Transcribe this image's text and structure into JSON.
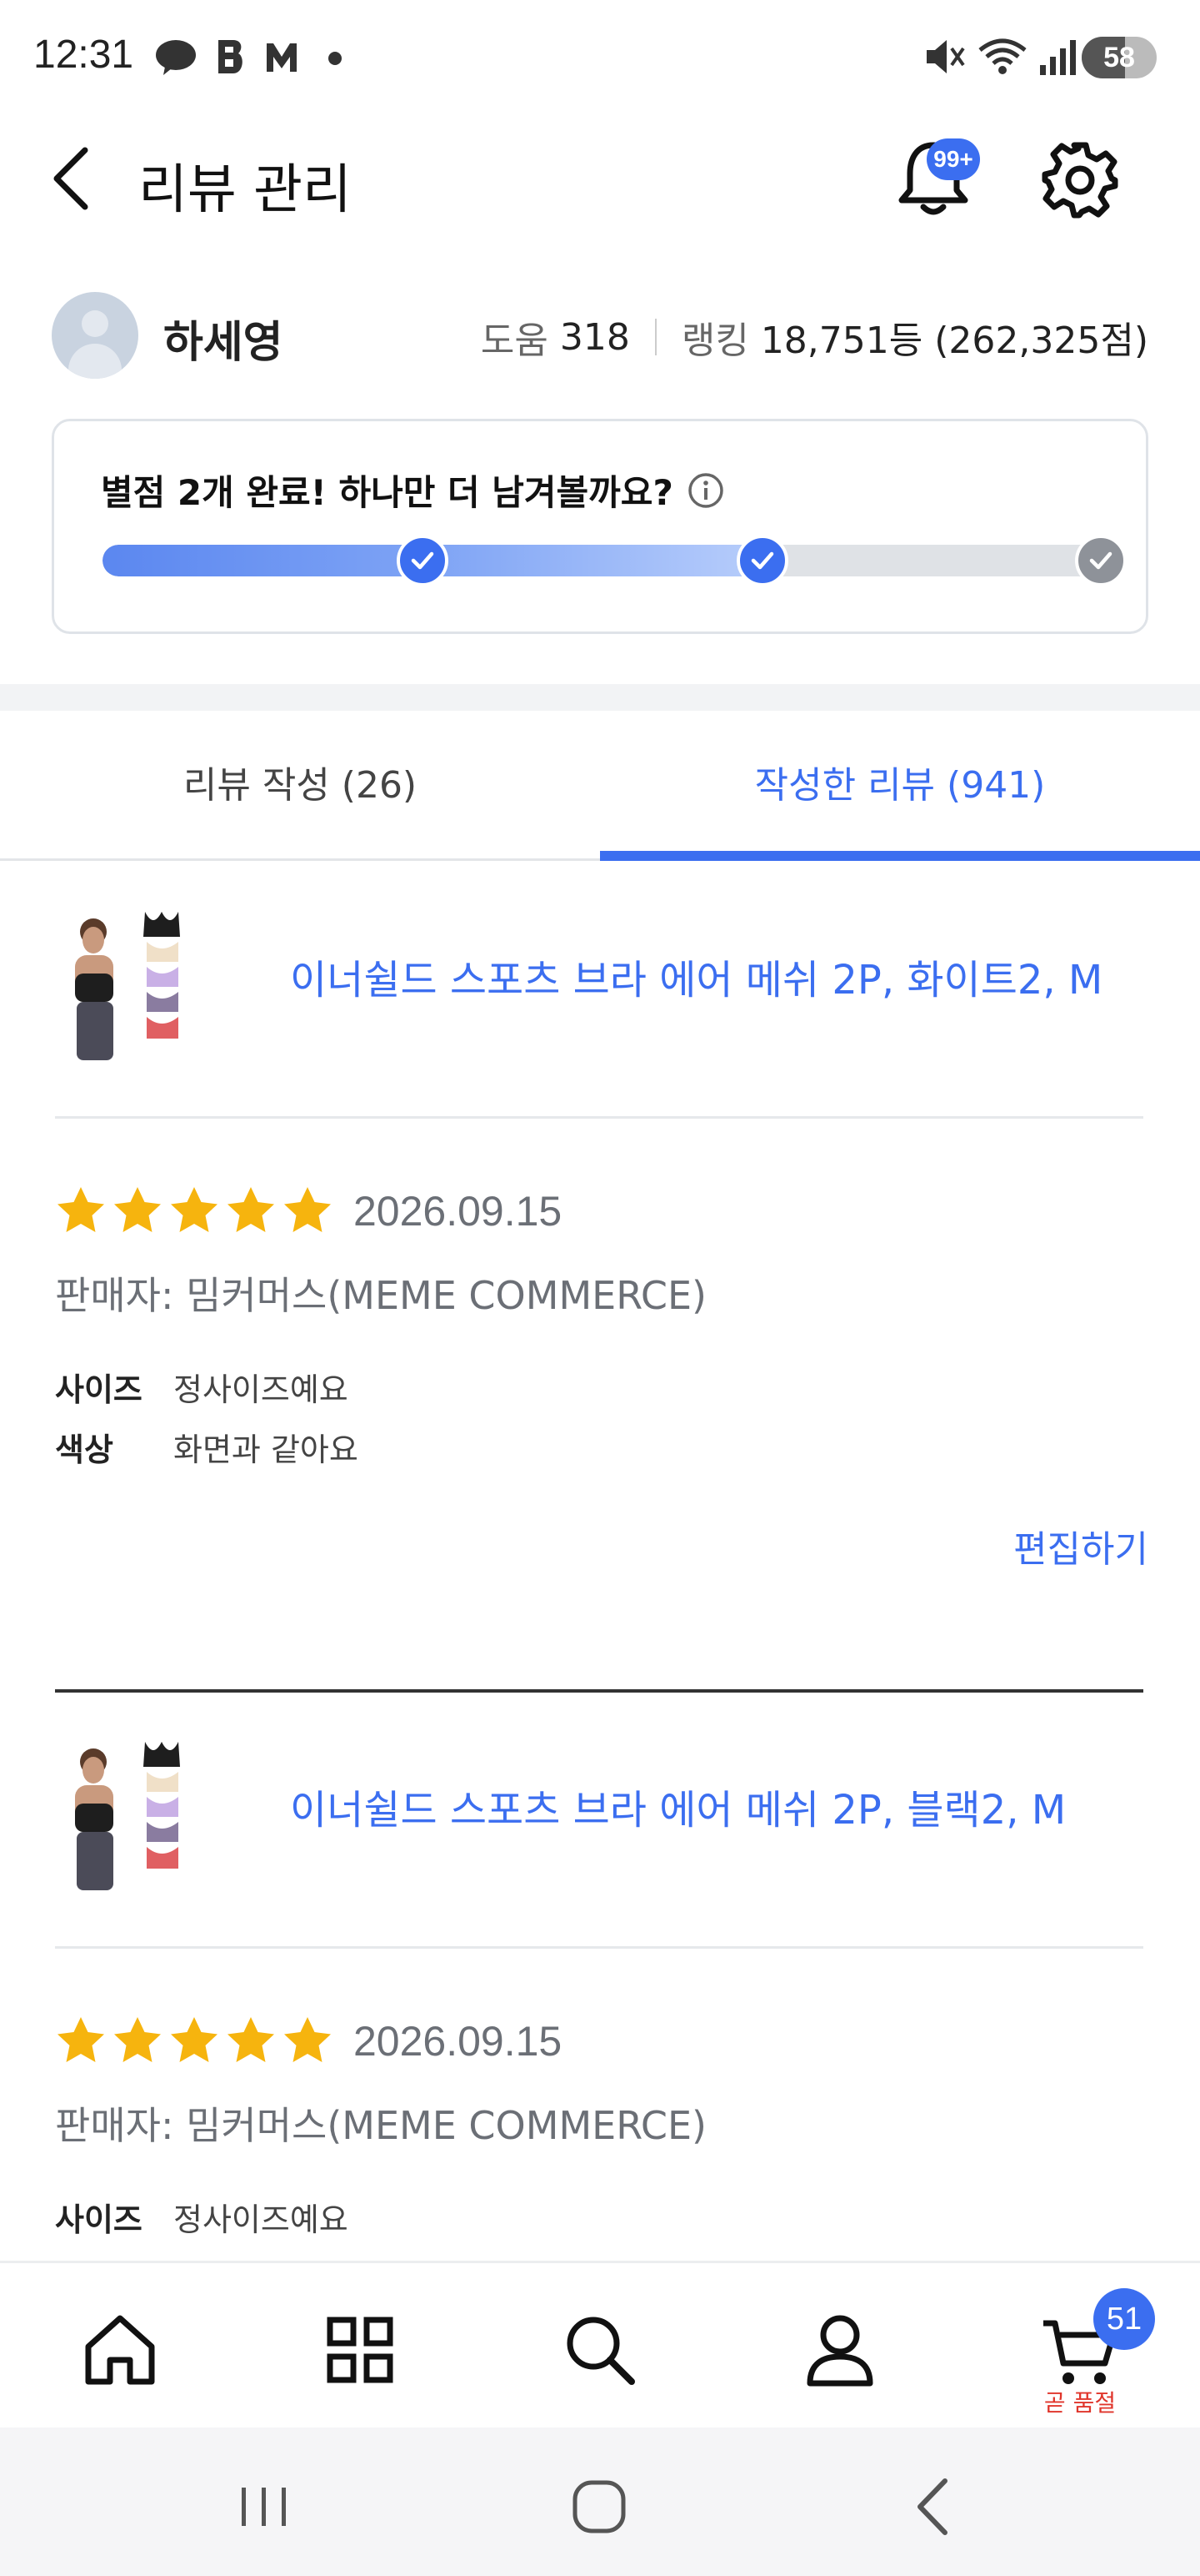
{
  "status_bar": {
    "time": "12:31",
    "battery": "58",
    "battery_level": 0.58,
    "left_icons": [
      "talk-icon",
      "b-app-icon",
      "m-app-icon",
      "dot-icon"
    ],
    "right_icons": [
      "mute-icon",
      "wifi-icon",
      "signal-icon",
      "battery-icon"
    ]
  },
  "header": {
    "title": "리뷰 관리",
    "notification_badge": "99+"
  },
  "profile": {
    "name": "하세영",
    "help_label": "도움",
    "help_value": "318",
    "ranking_label": "랭킹",
    "ranking_value": "18,751등 (262,325점)"
  },
  "progress": {
    "message": "별점 2개 완료! 하나만 더 남겨볼까요?",
    "completed_steps": 2,
    "total_steps": 3
  },
  "tabs": [
    {
      "label": "리뷰 작성 (26)",
      "active": false
    },
    {
      "label": "작성한 리뷰 (941)",
      "active": true
    }
  ],
  "reviews": [
    {
      "product_name": "이너쉴드 스포츠 브라 에어 메쉬 2P, 화이트2, M",
      "rating": 5,
      "date": "2026.09.15",
      "seller": "판매자: 밈커머스(MEME COMMERCE)",
      "attributes": [
        {
          "key": "사이즈",
          "value": "정사이즈예요"
        },
        {
          "key": "색상",
          "value": "화면과 같아요"
        }
      ],
      "edit_label": "편집하기"
    },
    {
      "product_name": "이너쉴드 스포츠 브라 에어 메쉬 2P, 블랙2, M",
      "rating": 5,
      "date": "2026.09.15",
      "seller": "판매자: 밈커머스(MEME COMMERCE)",
      "attributes": [
        {
          "key": "사이즈",
          "value": "정사이즈예요"
        }
      ]
    }
  ],
  "bottom_nav": {
    "items": [
      "home-icon",
      "category-icon",
      "search-icon",
      "my-page-icon",
      "cart-icon"
    ],
    "cart_badge": "51",
    "cart_label": "곧 품절"
  },
  "colors": {
    "accent": "#3b6ef0",
    "star": "#f6b40e",
    "cart_label": "#e0352b"
  }
}
